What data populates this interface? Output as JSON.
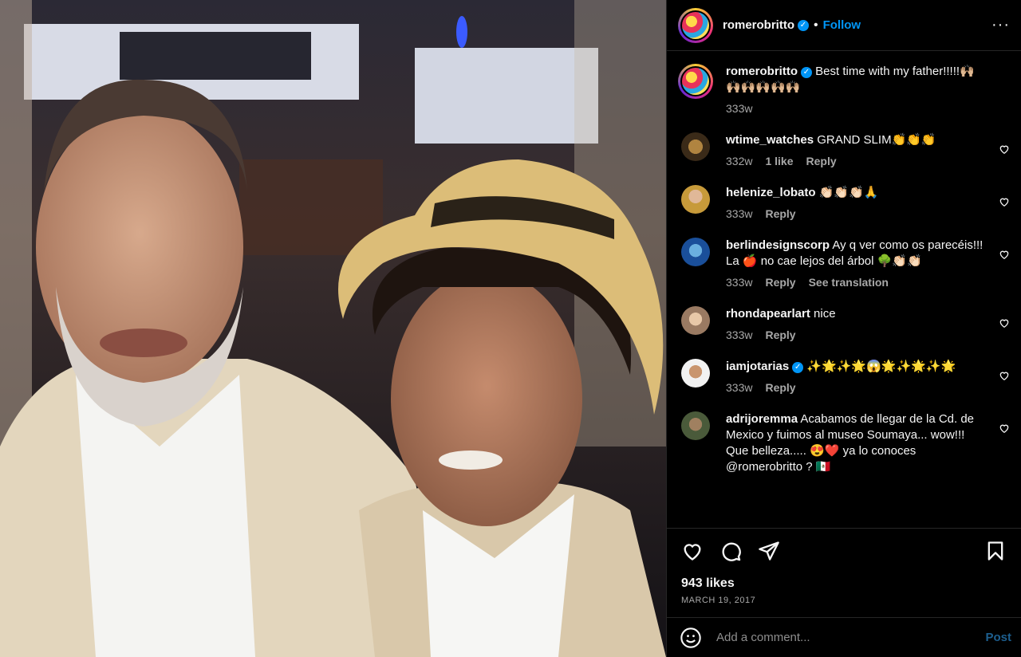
{
  "post": {
    "username": "romerobritto",
    "follow_label": "Follow",
    "dot": "•",
    "more_label": "···"
  },
  "caption": {
    "username": "romerobritto",
    "text": "Best time with my father!!!!!🙌🏼🙌🏼🙌🏼🙌🏼🙌🏼🙌🏼",
    "time": "333w"
  },
  "comments": [
    {
      "username": "wtime_watches",
      "text": "GRAND SLIM👏👏👏",
      "time": "332w",
      "likes": "1 like",
      "reply": "Reply",
      "translate": ""
    },
    {
      "username": "helenize_lobato",
      "text": "👏🏻👏🏻👏🏻🙏",
      "time": "333w",
      "likes": "",
      "reply": "Reply",
      "translate": ""
    },
    {
      "username": "berlindesignscorp",
      "text": "Ay q ver como os parecéis!!! La 🍎 no cae lejos del árbol 🌳👏🏻👏🏻",
      "time": "333w",
      "likes": "",
      "reply": "Reply",
      "translate": "See translation"
    },
    {
      "username": "rhondapearlart",
      "text": "nice",
      "time": "333w",
      "likes": "",
      "reply": "Reply",
      "translate": ""
    },
    {
      "username": "iamjotarias",
      "text": "✨🌟✨🌟😱🌟✨🌟✨🌟",
      "time": "333w",
      "likes": "",
      "reply": "Reply",
      "translate": ""
    },
    {
      "username": "adrijoremma",
      "text": "Acabamos de llegar de la Cd. de Mexico y fuimos al museo Soumaya... wow!!! Que belleza..... 😍❤️ ya lo conoces @romerobritto ? 🇲🇽",
      "time": "",
      "likes": "",
      "reply": "",
      "translate": ""
    }
  ],
  "likes_text": "943 likes",
  "date_text": "MARCH 19, 2017",
  "add_comment_placeholder": "Add a comment...",
  "post_label": "Post",
  "colors": {
    "accent": "#0095f6",
    "background": "#000000",
    "muted": "#a8a8a8"
  }
}
